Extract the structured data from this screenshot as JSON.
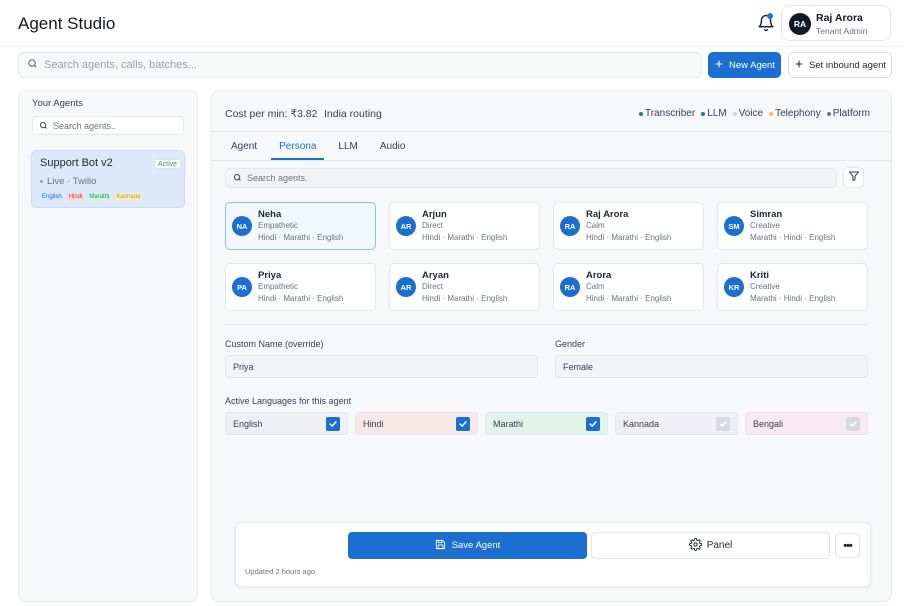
{
  "app": {
    "title": "Agent Studio"
  },
  "user": {
    "initials": "RA",
    "name": "Raj Arora",
    "role": "Tenant Admin"
  },
  "search": {
    "placeholder": "Search agents, calls, batches..."
  },
  "actions": {
    "new_agent": "New Agent",
    "set_inbound": "Set inbound agent"
  },
  "sidebar": {
    "title": "Your Agents",
    "search_placeholder": "Search agents..",
    "agents": [
      {
        "name": "Support Bot v2",
        "status": "Active",
        "subtitle": "Live · Twilio",
        "languages": [
          {
            "label": "English",
            "color": "#1b6fd1",
            "bg": "#d6e6fb"
          },
          {
            "label": "Hindi",
            "color": "#d14343",
            "bg": "#f8dada"
          },
          {
            "label": "Marathi",
            "color": "#1a9e5c",
            "bg": "#d5f0e1"
          },
          {
            "label": "Kannada",
            "color": "#c6a51f",
            "bg": "#f5ecc4"
          }
        ]
      }
    ]
  },
  "summary": {
    "cost": "Cost per min: ₹3.82",
    "routing": "India routing",
    "legend": [
      {
        "label": "Transcriber",
        "color": "#1b6fd1"
      },
      {
        "label": "LLM",
        "color": "#1b6fd1"
      },
      {
        "label": "Voice",
        "color": "#cfd3d8"
      },
      {
        "label": "Telephony",
        "color": "#f2c33a"
      },
      {
        "label": "Platform",
        "color": "#6b7280"
      }
    ]
  },
  "tabs": [
    {
      "label": "Agent",
      "active": false
    },
    {
      "label": "Persona",
      "active": true
    },
    {
      "label": "LLM",
      "active": false
    },
    {
      "label": "Audio",
      "active": false
    }
  ],
  "persona_search": {
    "placeholder": "Search agents."
  },
  "personas": [
    {
      "initials": "NA",
      "name": "Neha",
      "trait": "Empathetic",
      "langs": "Hindi · Marathi · English",
      "selected": true
    },
    {
      "initials": "AR",
      "name": "Arjun",
      "trait": "Direct",
      "langs": "Hindi · Marathi · English",
      "selected": false
    },
    {
      "initials": "RA",
      "name": "Raj Arora",
      "trait": "Calm",
      "langs": "Hindi · Marathi · English",
      "selected": false
    },
    {
      "initials": "SM",
      "name": "Simran",
      "trait": "Creative",
      "langs": "Marathi · Hindi · English",
      "selected": false
    },
    {
      "initials": "PA",
      "name": "Priya",
      "trait": "Empathetic",
      "langs": "Hindi · Marathi · English",
      "selected": false
    },
    {
      "initials": "AR",
      "name": "Aryan",
      "trait": "Direct",
      "langs": "Hindi · Marathi · English",
      "selected": false
    },
    {
      "initials": "RA",
      "name": "Arora",
      "trait": "Calm",
      "langs": "Hindi · Marathi · English",
      "selected": false
    },
    {
      "initials": "KR",
      "name": "Kriti",
      "trait": "Creative",
      "langs": "Marathi · Hindi · English",
      "selected": false
    }
  ],
  "form": {
    "custom_name_label": "Custom Name (override)",
    "custom_name_value": "Priya",
    "gender_label": "Gender",
    "gender_value": "Female",
    "languages_label": "Active Languages for this agent",
    "languages": [
      {
        "label": "English",
        "checked": true,
        "bg": "#eef0f4"
      },
      {
        "label": "Hindi",
        "checked": true,
        "bg": "#f8e9e9"
      },
      {
        "label": "Marathi",
        "checked": true,
        "bg": "#e4f3ea"
      },
      {
        "label": "Kannada",
        "checked": false,
        "bg": "#f0eff5"
      },
      {
        "label": "Bengali",
        "checked": false,
        "bg": "#f8eaf0"
      }
    ]
  },
  "footer": {
    "save": "Save Agent",
    "panel": "Panel",
    "more": "•••",
    "updated": "Updated 2 hours ago."
  }
}
